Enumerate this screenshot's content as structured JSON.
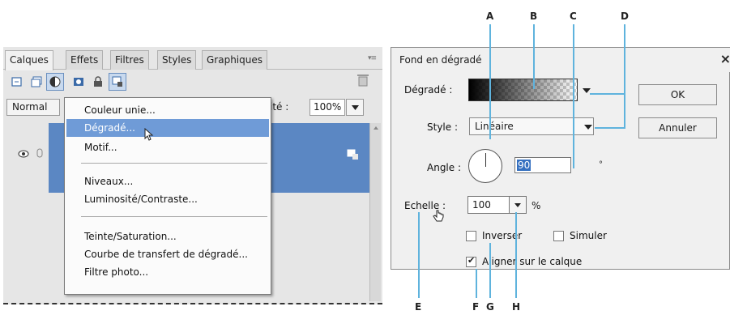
{
  "panel": {
    "tabs": [
      {
        "label": "Calques"
      },
      {
        "label": "Effets"
      },
      {
        "label": "Filtres"
      },
      {
        "label": "Styles"
      },
      {
        "label": "Graphiques"
      }
    ],
    "mode_value": "Normal",
    "opacity_label": "ité :",
    "opacity_value": "100%"
  },
  "menu": {
    "items": [
      "Couleur unie...",
      "Dégradé...",
      "Motif...",
      "Niveaux...",
      "Luminosité/Contraste...",
      "Teinte/Saturation...",
      "Courbe de transfert de dégradé...",
      "Filtre photo..."
    ],
    "highlighted_index": 1
  },
  "dialog": {
    "title": "Fond en dégradé",
    "close": "×",
    "gradient_label": "Dégradé :",
    "style_label": "Style :",
    "style_value": "Linéaire",
    "angle_label": "Angle :",
    "angle_value": "90",
    "degree_symbol": "°",
    "scale_label": "Echelle :",
    "scale_value": "100",
    "percent": "%",
    "checkboxes": [
      {
        "label": "Inverser",
        "checked": false
      },
      {
        "label": "Simuler",
        "checked": false
      },
      {
        "label": "Aligner sur le calque",
        "checked": true
      }
    ],
    "ok_label": "OK",
    "cancel_label": "Annuler"
  },
  "callouts": {
    "A": "A",
    "B": "B",
    "C": "C",
    "D": "D",
    "E": "E",
    "F": "F",
    "G": "G",
    "H": "H"
  },
  "colors": {
    "selection_blue": "#6f9bd7",
    "layer_blue": "#5b87c3",
    "callout_line": "#5fb3dd"
  }
}
